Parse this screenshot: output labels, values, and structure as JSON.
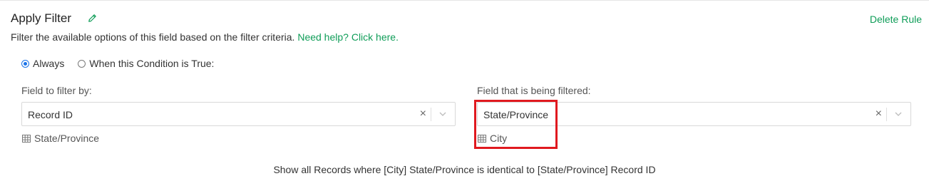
{
  "header": {
    "title": "Apply Filter",
    "delete_label": "Delete Rule"
  },
  "description": {
    "text": "Filter the available options of this field based on the filter criteria.",
    "help_link": "Need help? Click here."
  },
  "condition": {
    "options": [
      {
        "label": "Always",
        "selected": true
      },
      {
        "label": "When this Condition is True:",
        "selected": false
      }
    ]
  },
  "filter_by": {
    "label": "Field to filter by:",
    "value": "Record ID",
    "source_table": "State/Province"
  },
  "filtered": {
    "label": "Field that is being filtered:",
    "value": "State/Province",
    "source_table": "City"
  },
  "summary": "Show all Records where [City] State/Province is identical to [State/Province] Record ID",
  "icons": {
    "edit": "pencil-icon",
    "clear": "clear-icon",
    "dropdown": "chevron-down-icon",
    "table": "table-icon"
  },
  "colors": {
    "accent_green": "#0f9d58",
    "radio_blue": "#1a73e8",
    "highlight_red": "#e0191f"
  }
}
